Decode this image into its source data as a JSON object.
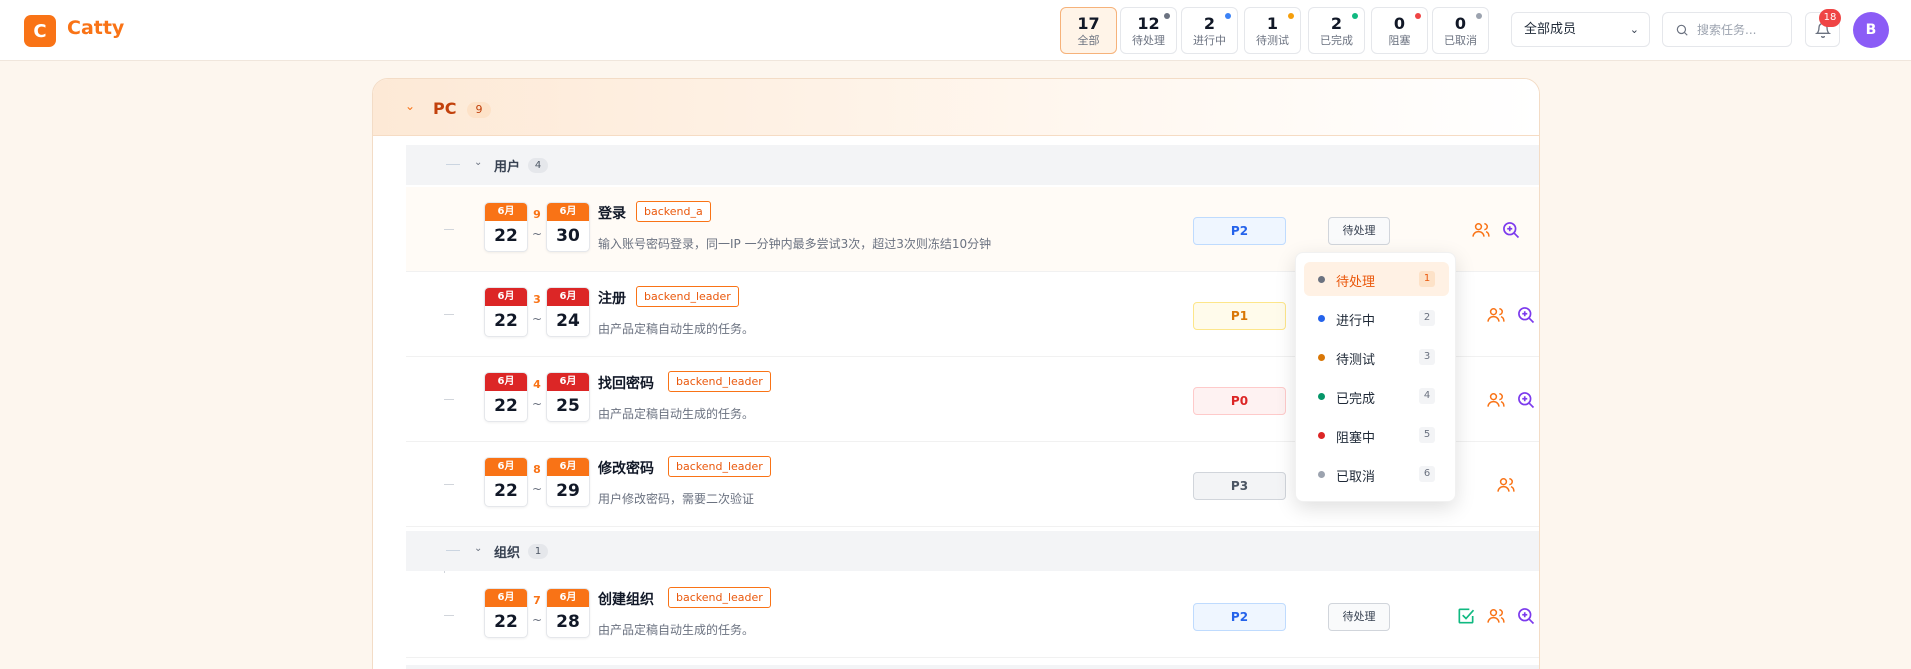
{
  "app": {
    "logo_letter": "C",
    "title": "Catty"
  },
  "stats": [
    {
      "num": "17",
      "label": "全部",
      "active": true
    },
    {
      "num": "12",
      "label": "待处理",
      "dot": "#6b7280"
    },
    {
      "num": "2",
      "label": "进行中",
      "dot": "#3b82f6"
    },
    {
      "num": "1",
      "label": "待测试",
      "dot": "#f59e0b"
    },
    {
      "num": "2",
      "label": "已完成",
      "dot": "#10b981"
    },
    {
      "num": "0",
      "label": "阻塞",
      "dot": "#ef4444"
    },
    {
      "num": "0",
      "label": "已取消",
      "dot": "#9ca3af"
    }
  ],
  "header": {
    "member_select": "全部成员",
    "search_placeholder": "搜索任务...",
    "notifications": "18",
    "avatar": "B"
  },
  "group": {
    "name": "PC",
    "count": "9"
  },
  "subgroups": [
    {
      "name": "用户",
      "count": "4"
    },
    {
      "name": "组织",
      "count": "1"
    }
  ],
  "tasks": [
    {
      "start_month": "6月",
      "start_day": "22",
      "end_month": "6月",
      "end_day": "30",
      "days": "9",
      "title": "登录",
      "tag": "backend_a",
      "desc": "输入账号密码登录，同一IP 一分钟内最多尝试3次，超过3次则冻结10分钟",
      "priority": "P2",
      "status": "待处理",
      "start_color": "orange",
      "end_color": "orange"
    },
    {
      "start_month": "6月",
      "start_day": "22",
      "end_month": "6月",
      "end_day": "24",
      "days": "3",
      "title": "注册",
      "tag": "backend_leader",
      "desc": "由产品定稿自动生成的任务。",
      "priority": "P1",
      "start_color": "red",
      "end_color": "red"
    },
    {
      "start_month": "6月",
      "start_day": "22",
      "end_month": "6月",
      "end_day": "25",
      "days": "4",
      "title": "找回密码",
      "tag": "backend_leader",
      "desc": "由产品定稿自动生成的任务。",
      "priority": "P0",
      "start_color": "red",
      "end_color": "red"
    },
    {
      "start_month": "6月",
      "start_day": "22",
      "end_month": "6月",
      "end_day": "29",
      "days": "8",
      "title": "修改密码",
      "tag": "backend_leader",
      "desc": "用户修改密码，需要二次验证",
      "priority": "P3",
      "start_color": "orange",
      "end_color": "orange"
    },
    {
      "start_month": "6月",
      "start_day": "22",
      "end_month": "6月",
      "end_day": "28",
      "days": "7",
      "title": "创建组织",
      "tag": "backend_leader",
      "desc": "由产品定稿自动生成的任务。",
      "priority": "P2",
      "status": "待处理",
      "start_color": "orange",
      "end_color": "orange"
    }
  ],
  "status_menu": [
    {
      "label": "待处理",
      "key": "1",
      "color": "#6b7280",
      "selected": true
    },
    {
      "label": "进行中",
      "key": "2",
      "color": "#2563eb"
    },
    {
      "label": "待测试",
      "key": "3",
      "color": "#d97706"
    },
    {
      "label": "已完成",
      "key": "4",
      "color": "#059669"
    },
    {
      "label": "阻塞中",
      "key": "5",
      "color": "#dc2626"
    },
    {
      "label": "已取消",
      "key": "6",
      "color": "#9ca3af"
    }
  ],
  "icons": {
    "assign": "users-icon",
    "detail": "zoom-in-icon",
    "done": "check-square-icon"
  }
}
